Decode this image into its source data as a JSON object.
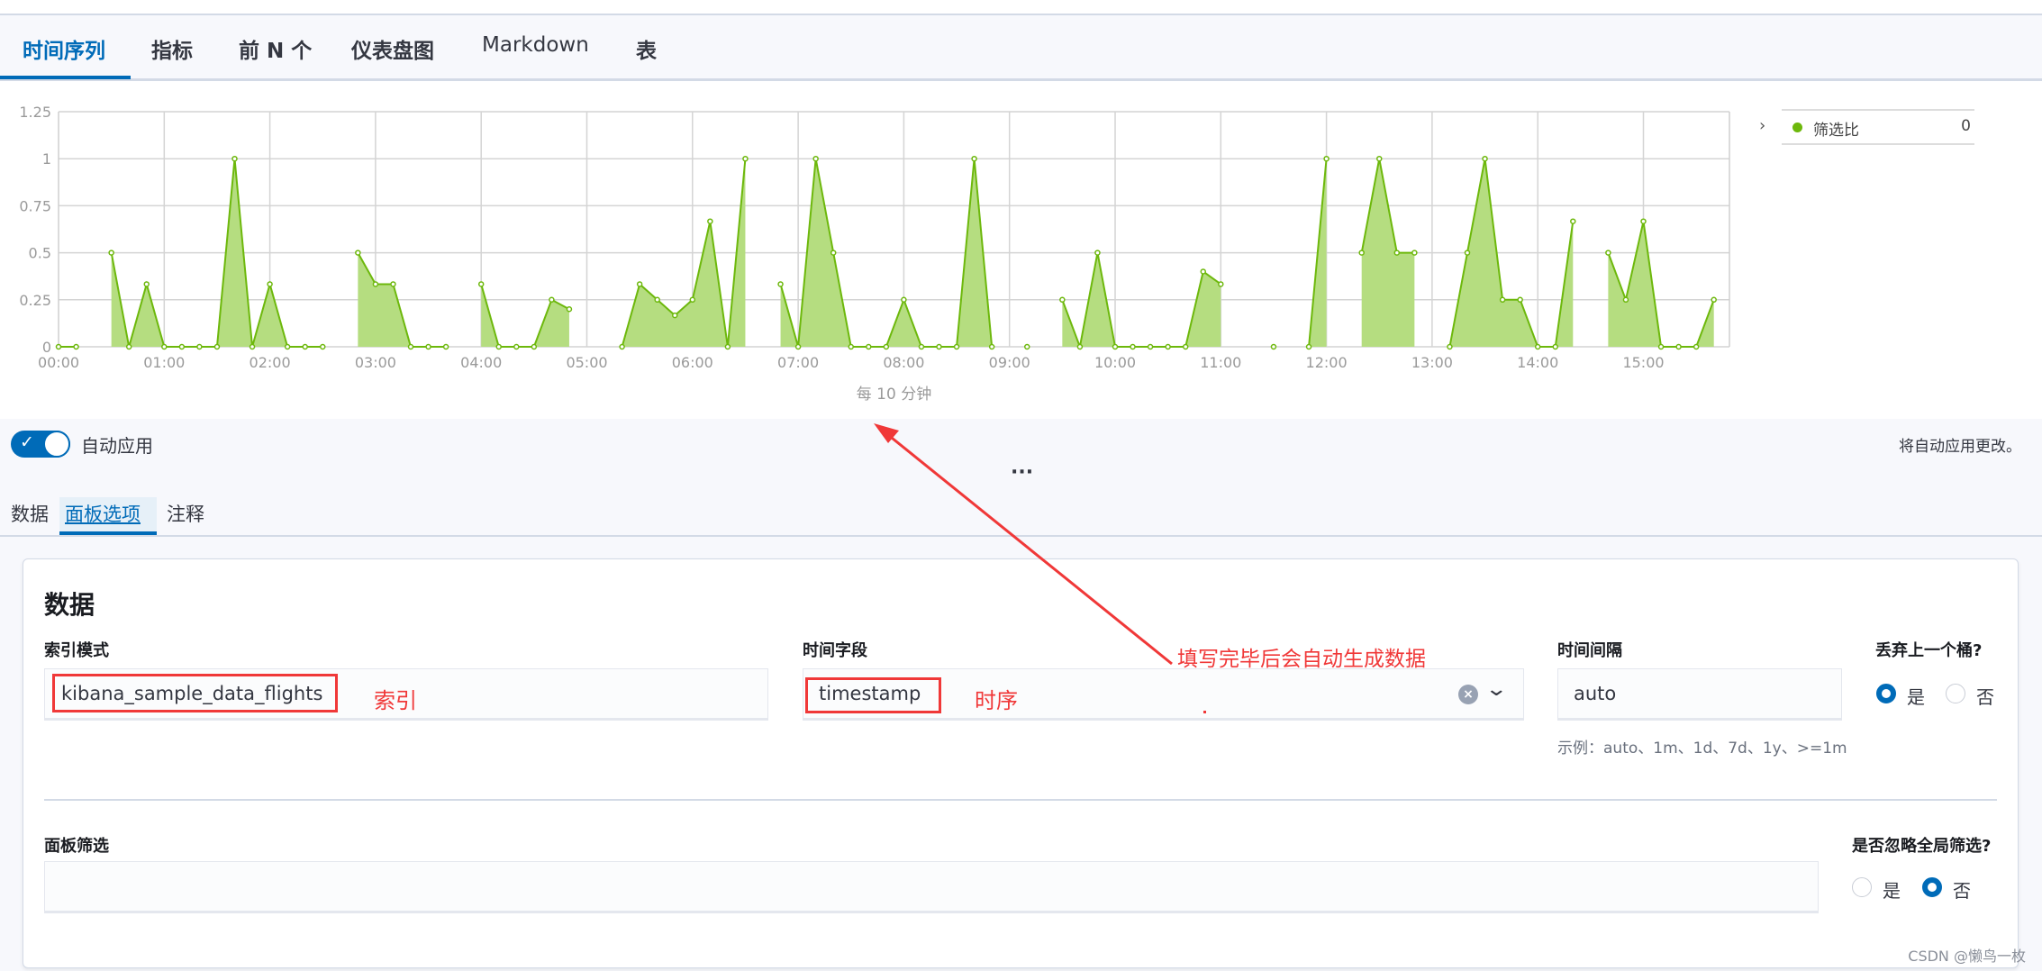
{
  "tabs": [
    "时间序列",
    "指标",
    "前 N 个",
    "仪表盘图",
    "Markdown",
    "表"
  ],
  "active_tab": 0,
  "legend": {
    "chevron_icon": "chevron-right-icon",
    "series": "筛选比",
    "value": "0",
    "color": "#6db80c"
  },
  "toolbar": {
    "auto_apply_label": "自动应用",
    "auto_apply_on": true,
    "auto_apply_note": "将自动应用更改。",
    "more_icon": "ellipsis-icon"
  },
  "subtabs": [
    "数据",
    "面板选项",
    "注释"
  ],
  "active_subtab": 1,
  "panel": {
    "heading": "数据",
    "index_label": "索引模式",
    "index_value": "kibana_sample_data_flights",
    "time_field_label": "时间字段",
    "time_field_value": "timestamp",
    "interval_label": "时间间隔",
    "interval_value": "auto",
    "interval_hint": "示例：auto、1m、1d、7d、1y、>=1m",
    "drop_bucket_label": "丢弃上一个桶?",
    "drop_bucket_yes": "是",
    "drop_bucket_no": "否",
    "drop_bucket_selected": "是",
    "filter_label": "面板筛选",
    "filter_value": "",
    "ignore_global_label": "是否忽略全局筛选?",
    "ignore_yes": "是",
    "ignore_no": "否",
    "ignore_selected": "否"
  },
  "annotations": {
    "index_note": "索引",
    "time_note": "时序",
    "arrow_note": "填写完毕后会自动生成数据",
    "color": "#f03838"
  },
  "watermark": "CSDN @懒鸟一枚",
  "chart_data": {
    "type": "area",
    "xlabel": "每 10 分钟",
    "ylabel": "",
    "ylim": [
      0,
      1.25
    ],
    "yticks": [
      "0",
      "0.25",
      "0.5",
      "0.75",
      "1",
      "1.25"
    ],
    "xticks": [
      "00:00",
      "01:00",
      "02:00",
      "03:00",
      "04:00",
      "05:00",
      "06:00",
      "07:00",
      "08:00",
      "09:00",
      "10:00",
      "11:00",
      "12:00",
      "13:00",
      "14:00",
      "15:00"
    ],
    "grid": true,
    "legend_position": "right",
    "series": [
      {
        "name": "筛选比",
        "color": "#6db80c",
        "x": [
          "00:00",
          "00:10",
          "00:20",
          "00:30",
          "00:40",
          "00:50",
          "01:00",
          "01:10",
          "01:20",
          "01:30",
          "01:40",
          "01:50",
          "02:00",
          "02:10",
          "02:20",
          "02:30",
          "02:40",
          "02:50",
          "03:00",
          "03:10",
          "03:20",
          "03:30",
          "03:40",
          "03:50",
          "04:00",
          "04:10",
          "04:20",
          "04:30",
          "04:40",
          "04:50",
          "05:00",
          "05:10",
          "05:20",
          "05:30",
          "05:40",
          "05:50",
          "06:00",
          "06:10",
          "06:20",
          "06:30",
          "06:40",
          "06:50",
          "07:00",
          "07:10",
          "07:20",
          "07:30",
          "07:40",
          "07:50",
          "08:00",
          "08:10",
          "08:20",
          "08:30",
          "08:40",
          "08:50",
          "09:00",
          "09:10",
          "09:20",
          "09:30",
          "09:40",
          "09:50",
          "10:00",
          "10:10",
          "10:20",
          "10:30",
          "10:40",
          "10:50",
          "11:00",
          "11:10",
          "11:20",
          "11:30",
          "11:40",
          "11:50",
          "12:00",
          "12:10",
          "12:20",
          "12:30",
          "12:40",
          "12:50",
          "13:00",
          "13:10",
          "13:20",
          "13:30",
          "13:40",
          "13:50",
          "14:00",
          "14:10",
          "14:20",
          "14:30",
          "14:40",
          "14:50",
          "15:00",
          "15:10",
          "15:20",
          "15:30",
          "15:40"
        ],
        "values": [
          0,
          0,
          null,
          0.5,
          0,
          0.333,
          0,
          0,
          0,
          0,
          1,
          0,
          0.333,
          0,
          0,
          0,
          null,
          0.5,
          0.333,
          0.333,
          0,
          0,
          0,
          null,
          0.333,
          0,
          0,
          0,
          0.25,
          0.2,
          null,
          null,
          0,
          0.333,
          0.25,
          0.167,
          0.25,
          0.667,
          0,
          1,
          null,
          0.333,
          0,
          1,
          0.5,
          0,
          0,
          0,
          0.25,
          0,
          0,
          0,
          1,
          0,
          null,
          0,
          null,
          0.25,
          0,
          0.5,
          0,
          0,
          0,
          0,
          0,
          0.4,
          0.333,
          null,
          null,
          0,
          null,
          0,
          1,
          null,
          0.5,
          1,
          0.5,
          0.5,
          null,
          0,
          0.5,
          1,
          0.25,
          0.25,
          0,
          0,
          0.667,
          null,
          0.5,
          0.25,
          0.667,
          0,
          0,
          0,
          0.25
        ]
      }
    ]
  }
}
